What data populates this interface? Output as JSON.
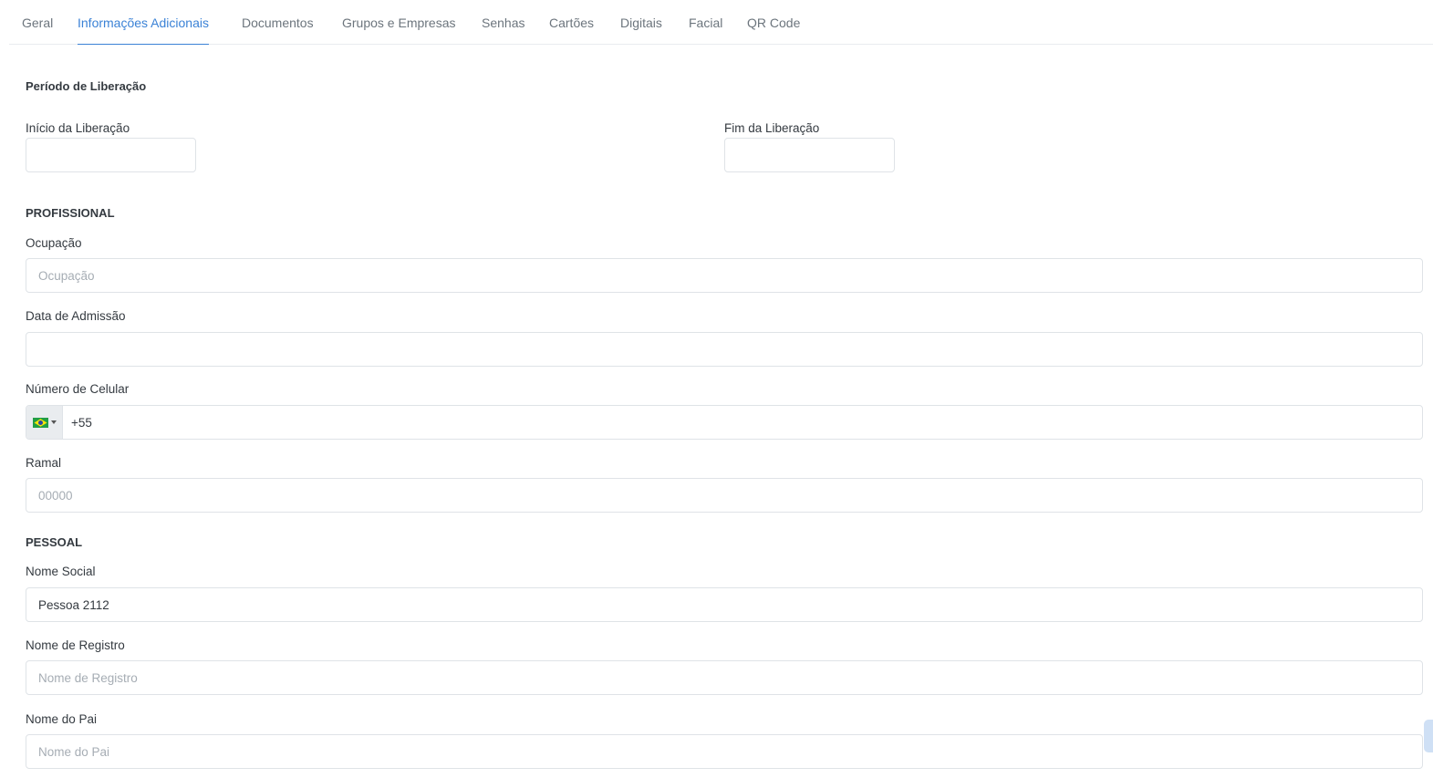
{
  "tabs": [
    {
      "label": "Geral"
    },
    {
      "label": "Informações Adicionais"
    },
    {
      "label": "Documentos"
    },
    {
      "label": "Grupos e Empresas"
    },
    {
      "label": "Senhas"
    },
    {
      "label": "Cartões"
    },
    {
      "label": "Digitais"
    },
    {
      "label": "Facial"
    },
    {
      "label": "QR Code"
    }
  ],
  "active_tab": "Informações Adicionais",
  "accent_color": "#3b82d6",
  "release_period": {
    "title": "Período de Liberação",
    "start_label": "Início da Liberação",
    "start_value": "",
    "end_label": "Fim da Liberação",
    "end_value": ""
  },
  "professional": {
    "title": "PROFISSIONAL",
    "occupation_label": "Ocupação",
    "occupation_placeholder": "Ocupação",
    "admission_label": "Data de Admissão",
    "admission_value": "",
    "phone_label": "Número de Celular",
    "phone_flag": "brazil-flag-icon",
    "phone_value": "+55",
    "extension_label": "Ramal",
    "extension_placeholder": "00000"
  },
  "personal": {
    "title": "PESSOAL",
    "social_name_label": "Nome Social",
    "social_name_value": "Pessoa 2112",
    "registry_name_label": "Nome de Registro",
    "registry_name_placeholder": "Nome de Registro",
    "father_name_label": "Nome do Pai",
    "father_name_placeholder": "Nome do Pai"
  }
}
